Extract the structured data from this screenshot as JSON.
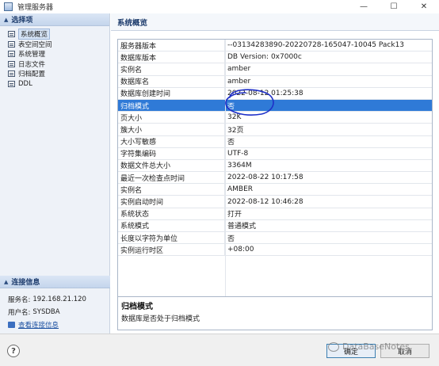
{
  "window": {
    "title": "管理服务器",
    "minimize_glyph": "—",
    "maximize_glyph": "☐",
    "close_glyph": "✕"
  },
  "sidebar": {
    "header": "选择项",
    "items": [
      {
        "label": "系统概览",
        "selected": true
      },
      {
        "label": "表空间空间"
      },
      {
        "label": "系统管理"
      },
      {
        "label": "日志文件"
      },
      {
        "label": "归档配置"
      },
      {
        "label": "DDL"
      }
    ]
  },
  "connection": {
    "header": "连接信息",
    "server_label": "服务名:",
    "server_value": "192.168.21.120",
    "user_label": "用户名:",
    "user_value": "SYSDBA",
    "link_label": "查看连接信息"
  },
  "main": {
    "title": "系统概览",
    "properties": [
      {
        "key": "服务器版本",
        "value": "--03134283890-20220728-165047-10045 Pack13"
      },
      {
        "key": "数据库版本",
        "value": "DB Version: 0x7000c"
      },
      {
        "key": "实例名",
        "value": "amber"
      },
      {
        "key": "数据库名",
        "value": "amber"
      },
      {
        "key": "数据库创建时间",
        "value": "2022-08-12 01:25:38"
      },
      {
        "key": "归档模式",
        "value": "否",
        "selected": true
      },
      {
        "key": "页大小",
        "value": "32K"
      },
      {
        "key": "簇大小",
        "value": "32页"
      },
      {
        "key": "大小写敏感",
        "value": "否"
      },
      {
        "key": "字符集编码",
        "value": "UTF-8"
      },
      {
        "key": "数据文件总大小",
        "value": "3364M"
      },
      {
        "key": "最近一次检查点时间",
        "value": "2022-08-22 10:17:58"
      },
      {
        "key": "实例名",
        "value": "AMBER"
      },
      {
        "key": "实例启动时间",
        "value": "2022-08-12 10:46:28"
      },
      {
        "key": "系统状态",
        "value": "打开"
      },
      {
        "key": "系统模式",
        "value": "普通模式"
      },
      {
        "key": "长度以字符为单位",
        "value": "否"
      },
      {
        "key": "实例运行时区",
        "value": "+08:00"
      }
    ],
    "description_title": "归档模式",
    "description_text": "数据库是否处于归档模式"
  },
  "footer": {
    "help_glyph": "?",
    "ok_label": "确定",
    "cancel_label": "取消",
    "watermark": "DataBaseNotes"
  },
  "colors": {
    "selection": "#2f7ad7",
    "header_text": "#1b3a6b",
    "annotation": "#1e2fc8"
  }
}
